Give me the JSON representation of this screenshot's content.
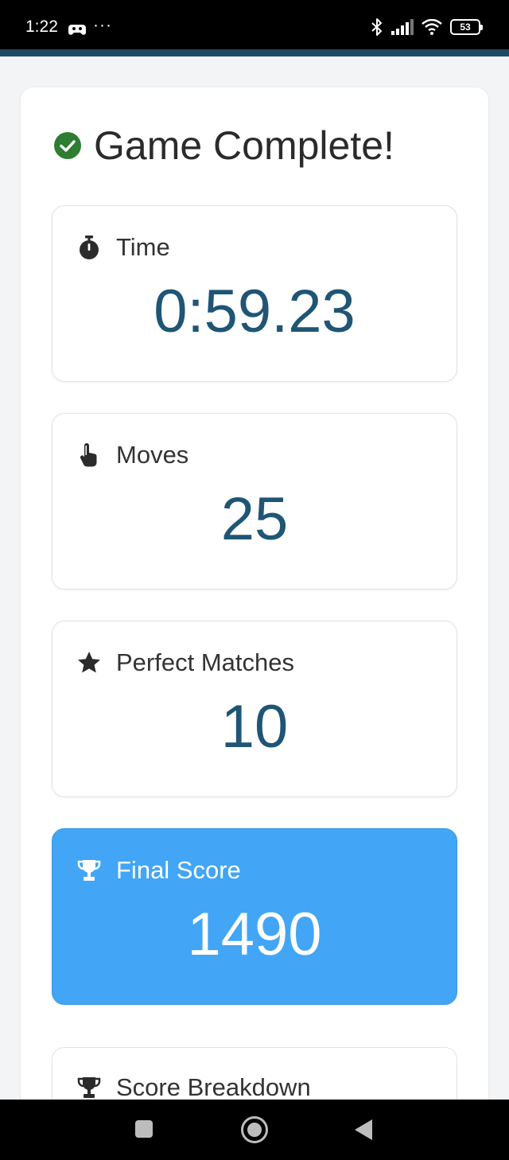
{
  "status_bar": {
    "time": "1:22",
    "more": "···",
    "battery": "53"
  },
  "header": {
    "title": "Game Complete!"
  },
  "stats": {
    "time": {
      "label": "Time",
      "value": "0:59.23"
    },
    "moves": {
      "label": "Moves",
      "value": "25"
    },
    "perfect": {
      "label": "Perfect Matches",
      "value": "10"
    },
    "score": {
      "label": "Final Score",
      "value": "1490"
    }
  },
  "breakdown": {
    "label": "Score Breakdown"
  },
  "colors": {
    "accent": "#1f5575",
    "highlight": "#42a5f5",
    "success": "#2e7d32"
  },
  "icons": {
    "title": "check-circle-icon",
    "time": "stopwatch-icon",
    "moves": "tap-hand-icon",
    "perfect": "star-icon",
    "score": "trophy-icon",
    "breakdown": "trophy-icon"
  }
}
